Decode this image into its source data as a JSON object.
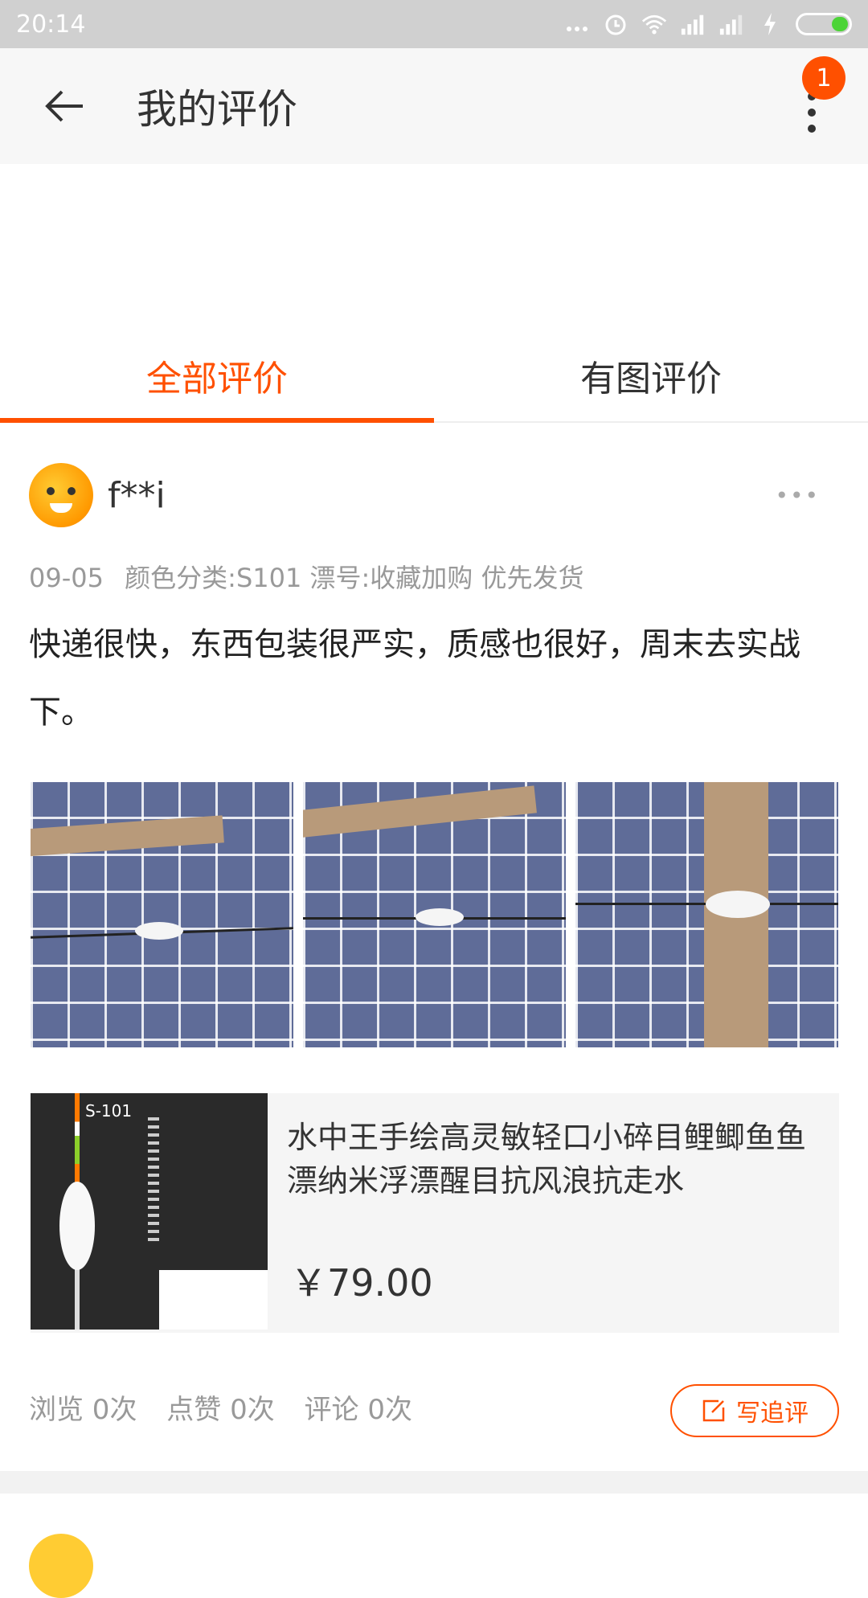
{
  "status_bar": {
    "time": "20:14",
    "icons": [
      "more-dots-icon",
      "alarm-icon",
      "wifi-icon",
      "signal-icon",
      "signal-icon",
      "charging-icon",
      "battery-icon"
    ],
    "battery_color": "#4cd437"
  },
  "app_bar": {
    "title": "我的评价",
    "badge_count": "1"
  },
  "tabs": [
    {
      "label": "全部评价",
      "active": true
    },
    {
      "label": "有图评价",
      "active": false
    }
  ],
  "review": {
    "username": "f**i",
    "date": "09-05",
    "spec": "颜色分类:S101 漂号:收藏加购 优先发货",
    "text": "快递很快，东西包装很严实，质感也很好，周末去实战下。",
    "product": {
      "name": "水中王手绘高灵敏轻口小碎目鲤鲫鱼鱼漂纳米浮漂醒目抗风浪抗走水",
      "price": "￥79.00",
      "image_code": "S-101"
    },
    "stats": {
      "views": "浏览 0次",
      "likes": "点赞 0次",
      "comments": "评论 0次"
    },
    "followup_label": "写追评"
  },
  "colors": {
    "accent": "#ff5000",
    "status_bar_bg": "#d0d0d0",
    "app_bar_bg": "#f7f7f7"
  }
}
